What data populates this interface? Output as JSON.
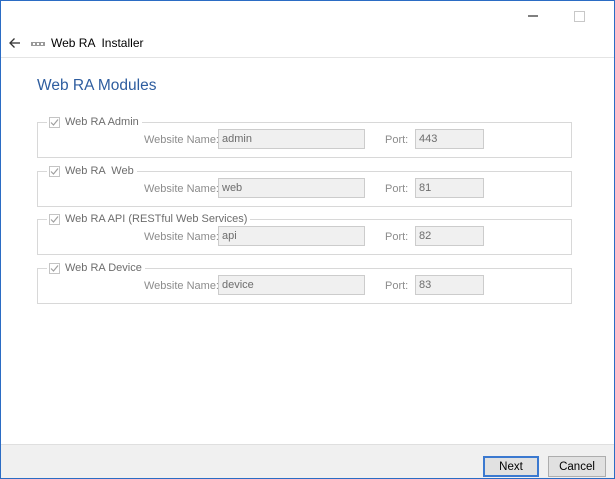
{
  "window": {
    "title": "Web RA  Installer",
    "minimize_icon": "minimize-icon",
    "maximize_icon": "maximize-icon",
    "back_icon": "back-arrow-icon",
    "logo_icon": "app-logo-icon"
  },
  "page": {
    "heading": "Web RA Modules"
  },
  "modules": [
    {
      "title": "Web RA Admin",
      "checked": true,
      "name_label": "Website Name:",
      "name_value": "admin",
      "port_label": "Port:",
      "port_value": "443"
    },
    {
      "title": "Web RA  Web",
      "checked": true,
      "name_label": "Website Name:",
      "name_value": "web",
      "port_label": "Port:",
      "port_value": "81"
    },
    {
      "title": "Web RA API (RESTful Web Services)",
      "checked": true,
      "name_label": "Website Name:",
      "name_value": "api",
      "port_label": "Port:",
      "port_value": "82"
    },
    {
      "title": "Web RA Device",
      "checked": true,
      "name_label": "Website Name:",
      "name_value": "device",
      "port_label": "Port:",
      "port_value": "83"
    }
  ],
  "footer": {
    "next_label": "Next",
    "cancel_label": "Cancel"
  },
  "colors": {
    "accent": "#2e5d9f",
    "window_border": "#2b6cc4",
    "disabled_text": "#8c8c8c"
  }
}
